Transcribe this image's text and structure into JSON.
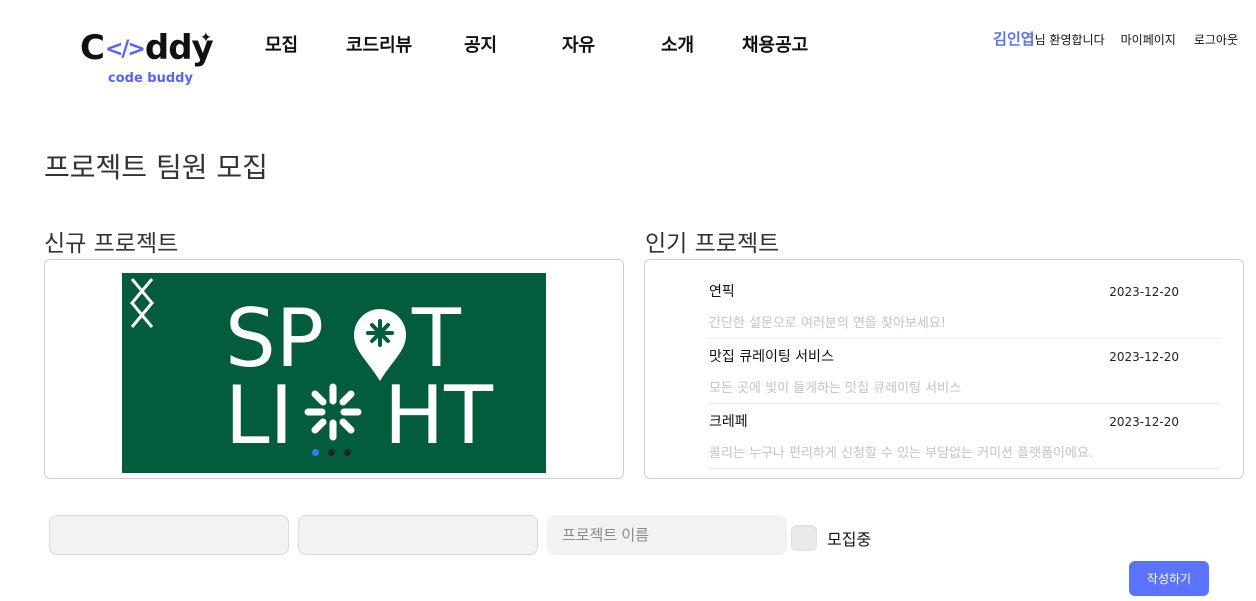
{
  "logo": {
    "text_start": "C",
    "code_mark": "</>",
    "text_end": "ddy",
    "subtitle": "code buddy"
  },
  "nav": [
    {
      "label": "모집"
    },
    {
      "label": "코드리뷰"
    },
    {
      "label": "공지"
    },
    {
      "label": "자유"
    },
    {
      "label": "소개"
    },
    {
      "label": "채용공고"
    }
  ],
  "user": {
    "name": "김인엽",
    "greeting": "님 환영합니다",
    "mypage": "마이페이지",
    "logout": "로그아웃"
  },
  "page_title": "프로젝트 팀원 모집",
  "new_projects": {
    "title": "신규 프로젝트",
    "slide_line1": "SP T",
    "slide_line2": "LI HT",
    "slide_count": 3,
    "active_slide": 1
  },
  "popular_projects": {
    "title": "인기 프로젝트",
    "items": [
      {
        "title": "연픽",
        "date": "2023-12-20",
        "desc": "간단한 설문으로 여러분의 연을 찾아보세요!"
      },
      {
        "title": "맛집 큐레이팅 서비스",
        "date": "2023-12-20",
        "desc": "모든 곳에 빛이 들게하는 맛집 큐레이팅 서비스"
      },
      {
        "title": "크레페",
        "date": "2023-12-20",
        "desc": "콜리는 누구나 편리하게 신청할 수 있는 부담없는 커미션 플랫폼이에요."
      }
    ]
  },
  "filters": {
    "field1_value": "",
    "field2_value": "",
    "project_name_placeholder": "프로젝트 이름",
    "recruiting_label": "모집중"
  },
  "write_button": "작성하기",
  "colors": {
    "accent": "#5b73ff",
    "brand": "#5865f2",
    "slide_bg": "#035c3b"
  },
  "icons": [
    "sparkle-icon",
    "chevron-left-icon",
    "chevron-right-icon",
    "location-pin-icon"
  ]
}
